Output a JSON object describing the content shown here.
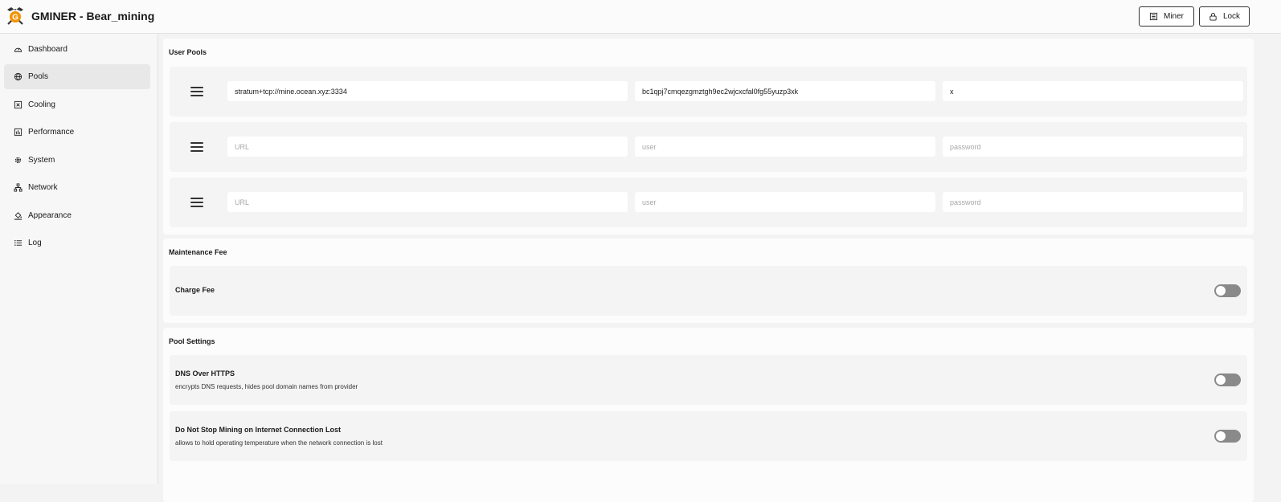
{
  "app": {
    "title": "GMINER - Bear_mining",
    "logo_letter": "G"
  },
  "header": {
    "miner_label": "Miner",
    "lock_label": "Lock"
  },
  "sidebar": {
    "items": [
      {
        "label": "Dashboard",
        "icon": "dashboard-gauge-icon",
        "active": false
      },
      {
        "label": "Pools",
        "icon": "globe-icon",
        "active": true
      },
      {
        "label": "Cooling",
        "icon": "fan-icon",
        "active": false
      },
      {
        "label": "Performance",
        "icon": "performance-bars-icon",
        "active": false
      },
      {
        "label": "System",
        "icon": "gear-icon",
        "active": false
      },
      {
        "label": "Network",
        "icon": "network-icon",
        "active": false
      },
      {
        "label": "Appearance",
        "icon": "paint-bucket-icon",
        "active": false
      },
      {
        "label": "Log",
        "icon": "list-icon",
        "active": false
      }
    ]
  },
  "user_pools": {
    "title": "User Pools",
    "pools": [
      {
        "url": "stratum+tcp://mine.ocean.xyz:3334",
        "user": "bc1qpj7cmqezgmztgh9ec2wjcxcfal0fg55yuzp3xk",
        "password": "x",
        "url_placeholder": "URL",
        "user_placeholder": "user",
        "password_placeholder": "password"
      },
      {
        "url": "",
        "user": "",
        "password": "",
        "url_placeholder": "URL",
        "user_placeholder": "user",
        "password_placeholder": "password"
      },
      {
        "url": "",
        "user": "",
        "password": "",
        "url_placeholder": "URL",
        "user_placeholder": "user",
        "password_placeholder": "password"
      }
    ]
  },
  "maintenance_fee": {
    "title": "Maintenance Fee",
    "charge_fee": {
      "label": "Charge Fee",
      "enabled": false
    }
  },
  "pool_settings": {
    "title": "Pool Settings",
    "dns_over_https": {
      "label": "DNS Over HTTPS",
      "description": "encrypts DNS requests, hides pool domain names from provider",
      "enabled": false
    },
    "keep_mining": {
      "label": "Do Not Stop Mining on Internet Connection Lost",
      "description": "allows to hold operating temperature when the network connection is lost",
      "enabled": false
    }
  },
  "colors": {
    "accent_orange": "#f39200",
    "toggle_off": "#8a8a8a",
    "active_nav": "#e8e8e8"
  }
}
